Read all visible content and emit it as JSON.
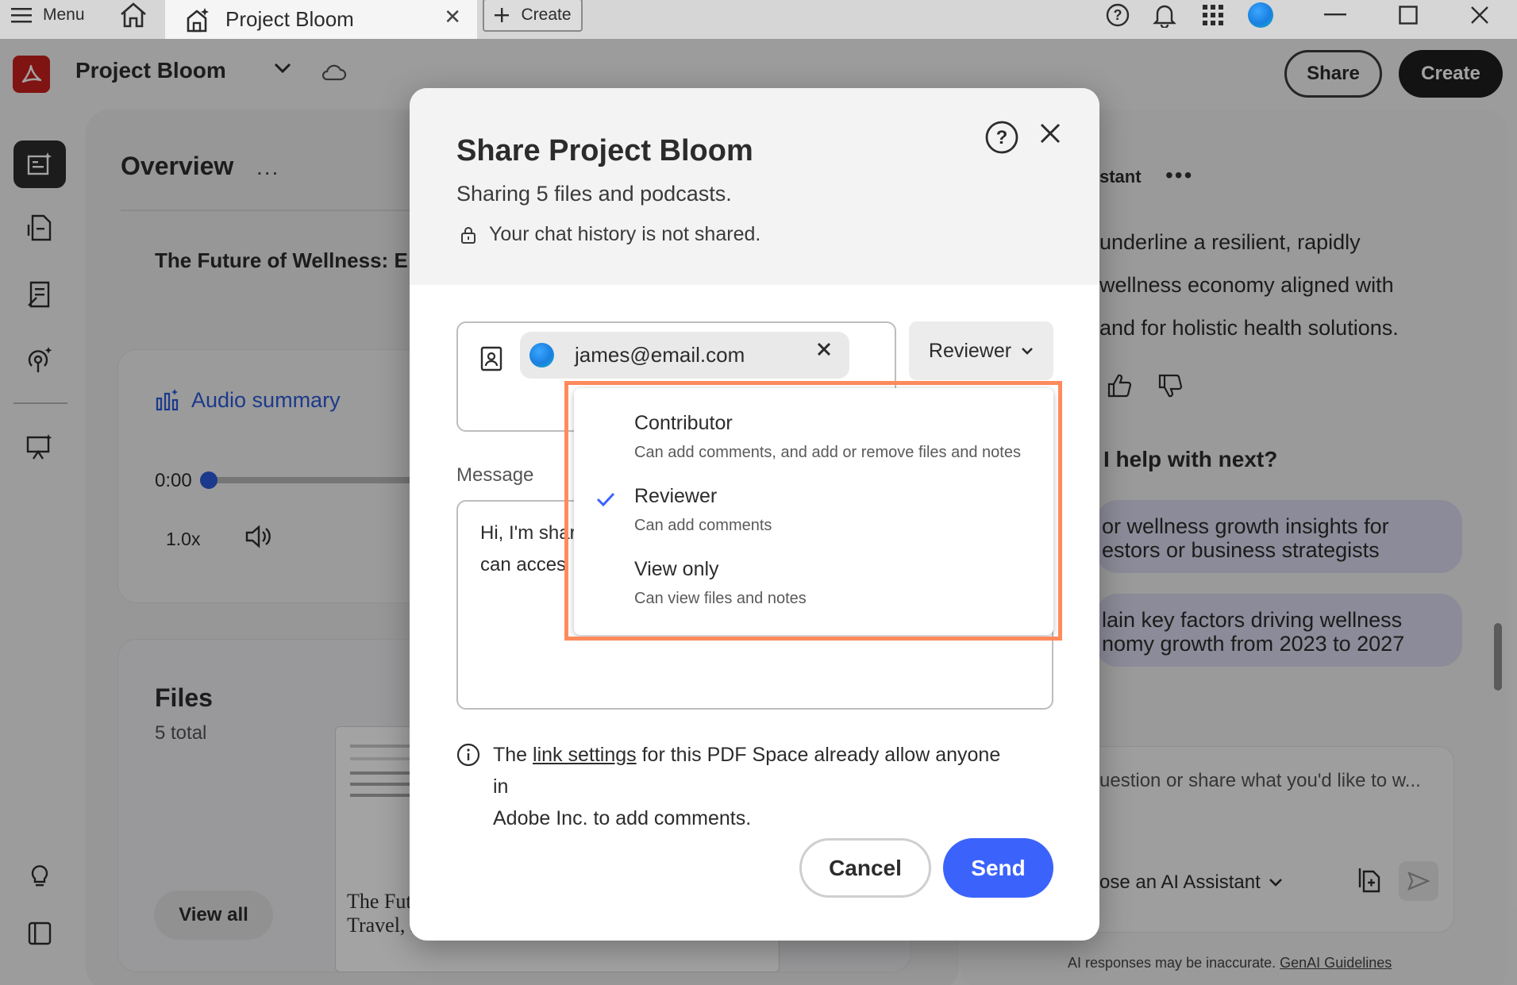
{
  "titlebar": {
    "menu_label": "Menu",
    "tab_label": "Project Bloom",
    "create_label": "Create",
    "icons": [
      "hamburger-icon",
      "home-icon",
      "project-space-icon",
      "close-icon",
      "plus-icon",
      "help-icon",
      "bell-icon",
      "app-grid-icon",
      "profile-avatar",
      "minimize-icon",
      "maximize-icon",
      "close-window-icon"
    ]
  },
  "header": {
    "title": "Project Bloom",
    "share_label": "Share",
    "create_label": "Create"
  },
  "main": {
    "overview_title": "Overview",
    "overview_more": "...",
    "doc_heading": "The Future of Wellness: E",
    "audio": {
      "title": "Audio summary",
      "time": "0:00",
      "speed": "1.0x"
    },
    "files": {
      "title": "Files",
      "count": "5 total",
      "view_all": "View all",
      "thumb_text": "The Fut\nTravel, I"
    }
  },
  "assistant": {
    "label": "stant",
    "more": "•••",
    "paragraph": "underline a resilient, rapidly\n wellness economy aligned with\nand for holistic health solutions.",
    "next_heading": "I help with next?",
    "suggestions": [
      {
        "line1": "or wellness growth insights for",
        "line2": "estors or business strategists"
      },
      {
        "line1": "lain key factors driving wellness",
        "line2": "nomy growth from 2023 to 2027"
      }
    ],
    "chat_placeholder": "uestion or share what you'd like to w...",
    "assistant_picker": "ose an AI Assistant",
    "disclaimer": "AI responses may be inaccurate.",
    "disclaimer_link": "GenAI Guidelines"
  },
  "modal": {
    "title": "Share Project Bloom",
    "subtitle": "Sharing 5 files and podcasts.",
    "privacy_note": "Your chat history is not shared.",
    "recipient_email": "james@email.com",
    "role_selected": "Reviewer",
    "message_label": "Message",
    "message_line1": "Hi, I'm shar",
    "message_line2": "can acces",
    "info_prefix": "The ",
    "info_link": "link settings",
    "info_suffix": " for this PDF Space already allow anyone in",
    "info_line2": "Adobe Inc. to add comments.",
    "cancel_label": "Cancel",
    "send_label": "Send"
  },
  "role_menu": {
    "items": [
      {
        "title": "Contributor",
        "desc": "Can add comments, and add or remove files and notes",
        "selected": false
      },
      {
        "title": "Reviewer",
        "desc": "Can add comments",
        "selected": true
      },
      {
        "title": "View only",
        "desc": "Can view files and notes",
        "selected": false
      }
    ]
  },
  "colors": {
    "accent_blue": "#3b63fb",
    "highlight": "#ff8a5c",
    "acrobat_red": "#c8201f",
    "suggestion_bg": "#d9d9ef"
  }
}
